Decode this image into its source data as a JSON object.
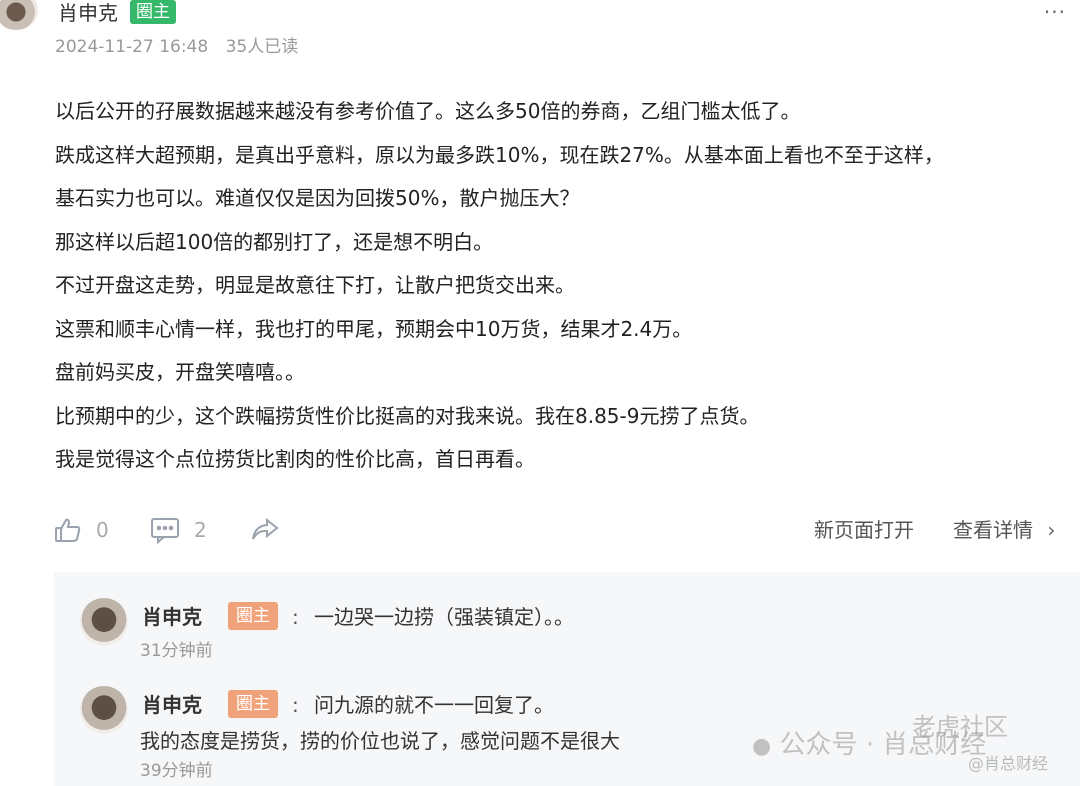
{
  "post": {
    "author": "肖申克",
    "badge": "圈主",
    "date": "2024-11-27 16:48",
    "views": "35人已读",
    "more_icon": "more-dots-icon",
    "lines": [
      "以后公开的孖展数据越来越没有参考价值了。这么多50倍的券商，乙组门槛太低了。",
      "跌成这样大超预期，是真出乎意料，原以为最多跌10%，现在跌27%。从基本面上看也不至于这样，",
      "基石实力也可以。难道仅仅是因为回拨50%，散户抛压大？",
      "那这样以后超100倍的都别打了，还是想不明白。",
      "不过开盘这走势，明显是故意往下打，让散户把货交出来。",
      "这票和顺丰心情一样，我也打的甲尾，预期会中10万货，结果才2.4万。",
      "盘前妈买皮，开盘笑嘻嘻。。",
      "比预期中的少，这个跌幅捞货性价比挺高的对我来说。我在8.85-9元捞了点货。",
      "我是觉得这个点位捞货比割肉的性价比高，首日再看。"
    ]
  },
  "actions": {
    "like_count": "0",
    "comment_count": "2",
    "open_new_page": "新页面打开",
    "view_details": "查看详情",
    "chevron": "›"
  },
  "replies": [
    {
      "name": "肖申克",
      "badge": "圈主",
      "colon": ":",
      "text": "一边哭一边捞（强装镇定）。。",
      "time": "31分钟前"
    },
    {
      "name": "肖申克",
      "badge": "圈主",
      "colon": ":",
      "text": "问九源的就不一一回复了。",
      "text2": "我的态度是捞货，捞的价位也说了，感觉问题不是很大",
      "time": "39分钟前"
    }
  ],
  "watermark": {
    "wechat": "公众号 · 肖总财经",
    "community": "老虎社区",
    "handle": "@肖总财经"
  },
  "colors": {
    "badge_green": "#35b86a",
    "badge_orange": "#f0a27a",
    "reply_bg": "#f6f7f9"
  }
}
